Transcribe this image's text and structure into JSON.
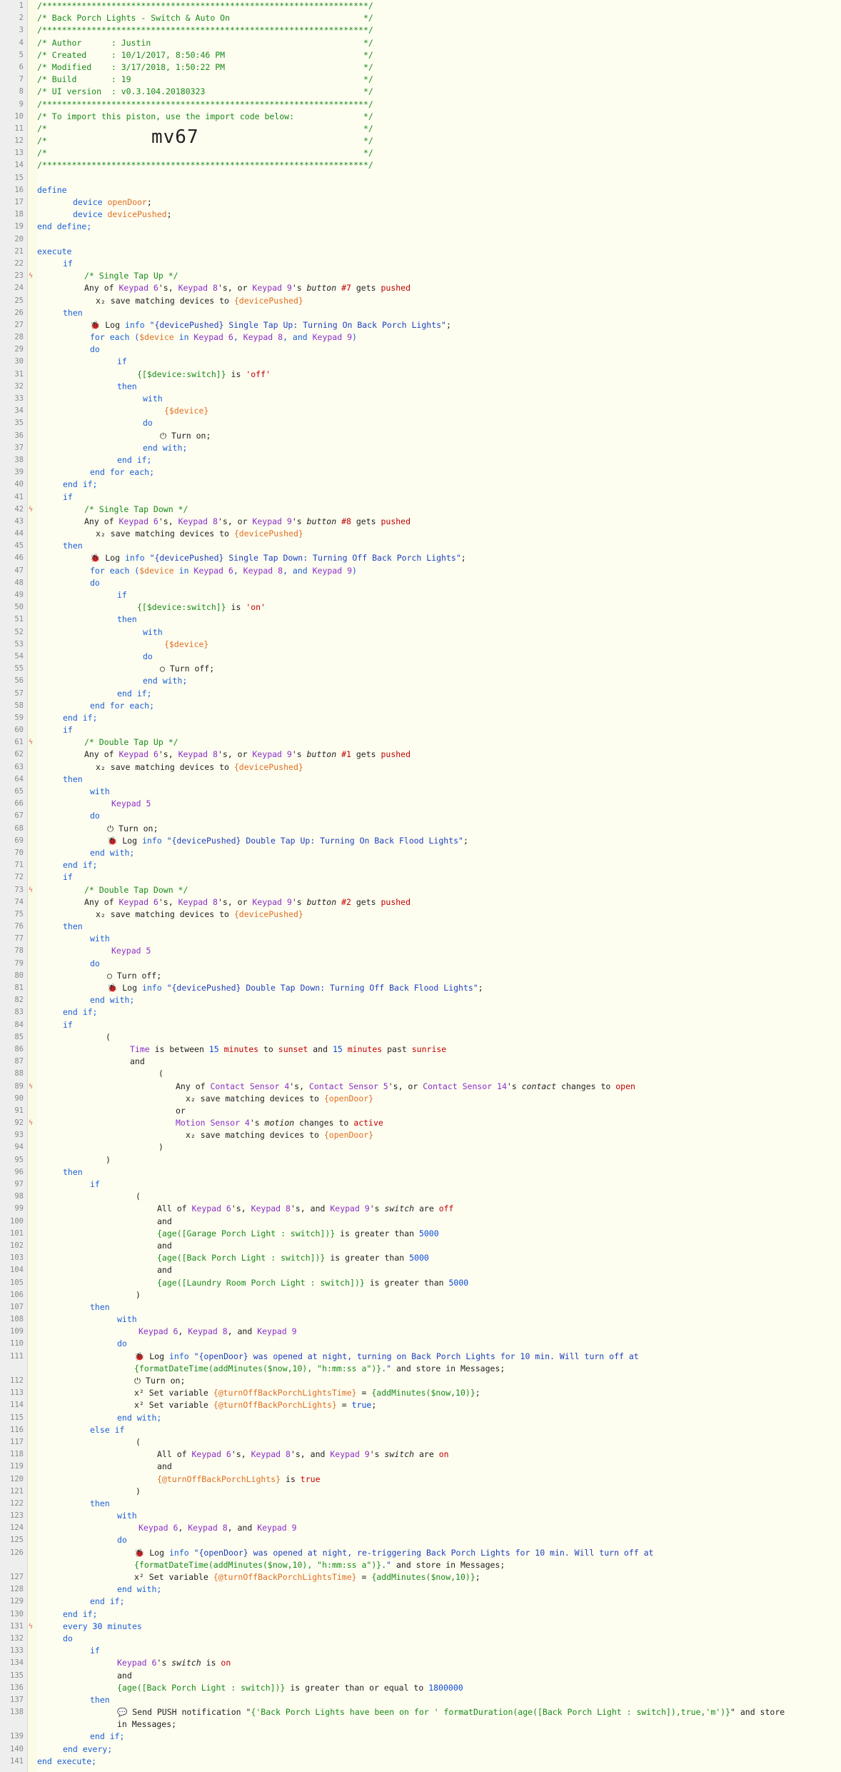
{
  "lines": [
    "/******************************************************************/",
    "/* Back Porch Lights - Switch & Auto On                           */",
    "/******************************************************************/",
    "/* Author      : Justin                                           */",
    "/* Created     : 10/1/2017, 8:50:46 PM                            */",
    "/* Modified    : 3/17/2018, 1:50:22 PM                            */",
    "/* Build       : 19                                               */",
    "/* UI version  : v0.3.104.20180323                                */",
    "/******************************************************************/",
    "/* To import this piston, use the import code below:              */",
    "/*                                                                */",
    "/*                                                                */",
    "/*                                                                */",
    "/******************************************************************/"
  ],
  "import_code": "mv67"
}
